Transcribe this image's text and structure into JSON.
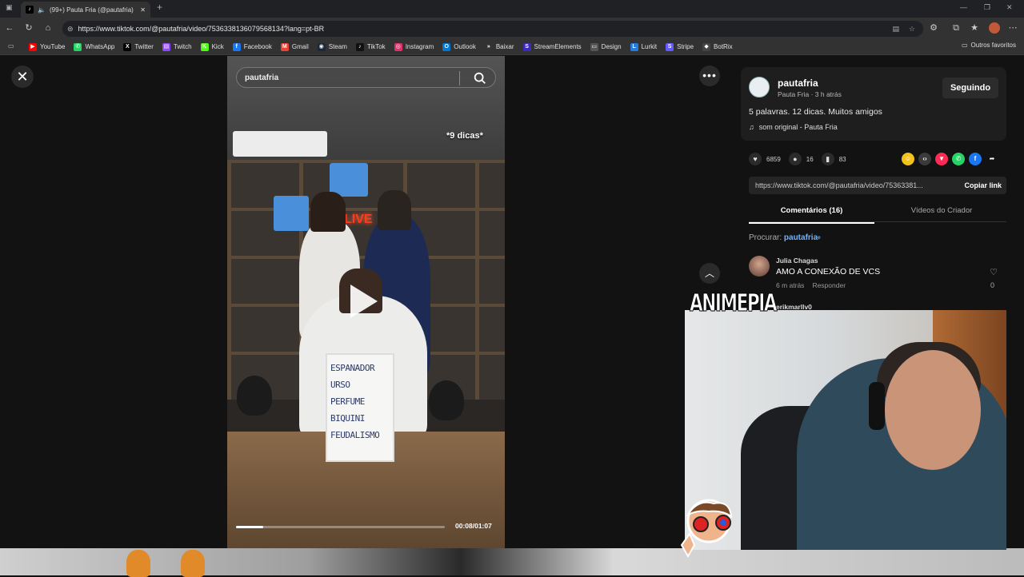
{
  "browser": {
    "tab_title": "(99+) Pauta Fria (@pautafria)",
    "tab_close": "✕",
    "new_tab": "+",
    "url": "https://www.tiktok.com/@pautafria/video/7536338136079568134?lang=pt-BR",
    "bookmarks": [
      {
        "label": "YouTube",
        "icon": "youtube-icon",
        "color": "#ff0000",
        "glyph": "▶"
      },
      {
        "label": "WhatsApp",
        "icon": "whatsapp-icon",
        "color": "#25d366",
        "glyph": "✆"
      },
      {
        "label": "Twitter",
        "icon": "x-icon",
        "color": "#000000",
        "glyph": "X"
      },
      {
        "label": "Twitch",
        "icon": "twitch-icon",
        "color": "#9146ff",
        "glyph": "▤"
      },
      {
        "label": "Kick",
        "icon": "kick-icon",
        "color": "#53fc18",
        "glyph": "K"
      },
      {
        "label": "Facebook",
        "icon": "facebook-icon",
        "color": "#1877f2",
        "glyph": "f"
      },
      {
        "label": "Gmail",
        "icon": "gmail-icon",
        "color": "#ea4335",
        "glyph": "M"
      },
      {
        "label": "Steam",
        "icon": "steam-icon",
        "color": "#1b2838",
        "glyph": "◉"
      },
      {
        "label": "TikTok",
        "icon": "tiktok-icon",
        "color": "#111111",
        "glyph": "♪"
      },
      {
        "label": "Instagram",
        "icon": "instagram-icon",
        "color": "#e1306c",
        "glyph": "◎"
      },
      {
        "label": "Outlook",
        "icon": "outlook-icon",
        "color": "#0078d4",
        "glyph": "O"
      },
      {
        "label": "Baixar",
        "icon": "download-icon",
        "color": "#333333",
        "glyph": "»"
      },
      {
        "label": "StreamElements",
        "icon": "streamelements-icon",
        "color": "#3c2bbb",
        "glyph": "S"
      },
      {
        "label": "Design",
        "icon": "folder-icon",
        "color": "#555555",
        "glyph": "▭"
      },
      {
        "label": "Lurkit",
        "icon": "lurkit-icon",
        "color": "#2a7bd9",
        "glyph": "L"
      },
      {
        "label": "Stripe",
        "icon": "stripe-icon",
        "color": "#635bff",
        "glyph": "S"
      },
      {
        "label": "BotRix",
        "icon": "botrix-icon",
        "color": "#444444",
        "glyph": "◆"
      }
    ],
    "other_favorites": "Outros favoritos"
  },
  "video": {
    "search_value": "pautafria",
    "caption": "*9 dicas*",
    "live_sign": "LIVE",
    "sign_lines": [
      "ESPANADOR",
      "URSO",
      "PERFUME",
      "BIQUINI",
      "FEUDALISMO"
    ],
    "time": "00:08/01:07",
    "progress": 0.13
  },
  "panel": {
    "username": "pautafria",
    "subtitle": "Pauta Fria · 3 h atrás",
    "follow_label": "Seguindo",
    "description": "5 palavras. 12 dicas. Muitos amigos",
    "sound": "som original - Pauta Fria",
    "likes": "6859",
    "comments": "16",
    "saves": "83",
    "link": "https://www.tiktok.com/@pautafria/video/75363381...",
    "copy_label": "Copiar link",
    "tab_comments": "Comentários (16)",
    "tab_creator": "Vídeos do Criador",
    "search_prefix": "Procurar:",
    "search_term": "pautafria",
    "comment": {
      "user": "Julia Chagas",
      "text": "AMO A CONEXÃO DE VCS",
      "time": "6 m atrás",
      "reply": "Responder",
      "likes": "0"
    },
    "next_comment_user": "erikmarllv0"
  },
  "overlay": {
    "brand": "ANIMEPIA"
  },
  "colors": {
    "accent": "#6cb5ff",
    "bg": "#121212"
  }
}
